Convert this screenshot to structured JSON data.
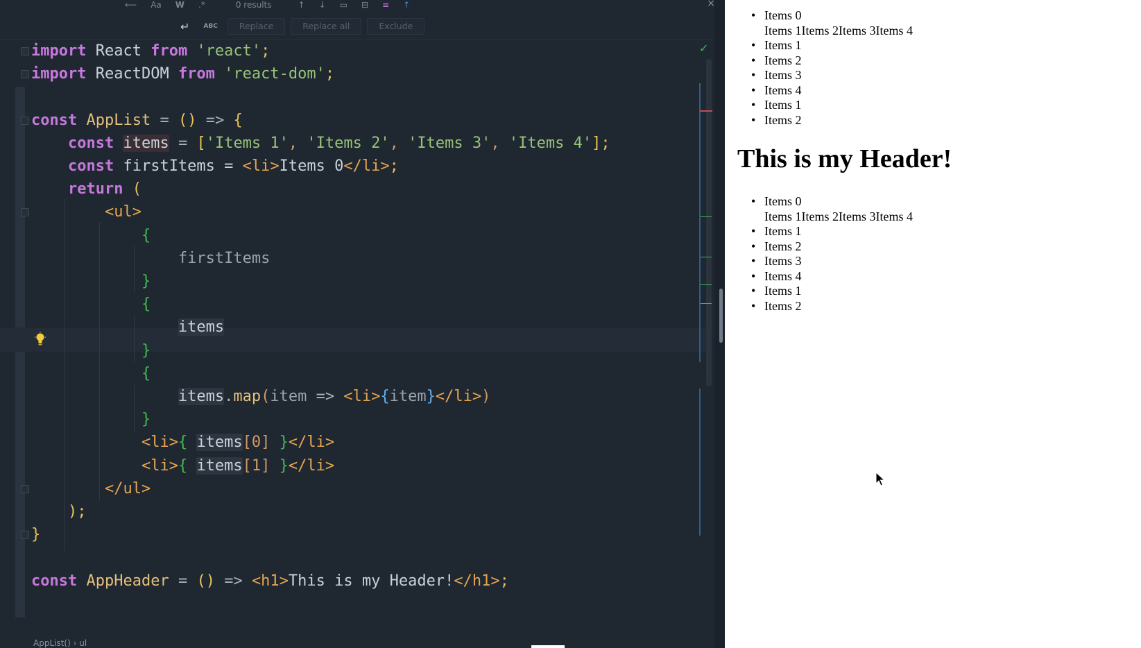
{
  "findbar": {
    "results": "0 results",
    "case_label": "Aa",
    "word_label": "W",
    "regex_label": ".*",
    "abc_label": "ABC",
    "replace_label": "Replace",
    "replace_all_label": "Replace all",
    "exclude_label": "Exclude",
    "close_label": "×"
  },
  "editor": {
    "lines": [
      {
        "tokens": [
          [
            "import",
            "k"
          ],
          [
            " React ",
            "v"
          ],
          [
            "from",
            "k"
          ],
          [
            " ",
            "v"
          ],
          [
            "'react'",
            "s"
          ],
          [
            ";",
            "y"
          ]
        ]
      },
      {
        "tokens": [
          [
            "import",
            "k"
          ],
          [
            " ReactDOM ",
            "v"
          ],
          [
            "from",
            "k"
          ],
          [
            " ",
            "v"
          ],
          [
            "'react-dom'",
            "s"
          ],
          [
            ";",
            "y"
          ]
        ]
      },
      {
        "tokens": []
      },
      {
        "tokens": [
          [
            "const",
            "k"
          ],
          [
            " ",
            "v"
          ],
          [
            "AppList",
            "fnb"
          ],
          [
            " = ",
            "p"
          ],
          [
            "()",
            "y"
          ],
          [
            " => ",
            "p"
          ],
          [
            "{",
            "y"
          ]
        ]
      },
      {
        "tokens": [
          [
            "    ",
            "v"
          ],
          [
            "const",
            "k"
          ],
          [
            " ",
            "v"
          ],
          [
            "items",
            "hlr"
          ],
          [
            " = ",
            "p"
          ],
          [
            "[",
            "y"
          ],
          [
            "'Items 1'",
            "s"
          ],
          [
            ", ",
            "pr"
          ],
          [
            "'Items 2'",
            "s"
          ],
          [
            ", ",
            "pr"
          ],
          [
            "'Items 3'",
            "s"
          ],
          [
            ", ",
            "pr"
          ],
          [
            "'Items 4'",
            "s"
          ],
          [
            "];",
            "y"
          ]
        ]
      },
      {
        "tokens": [
          [
            "    ",
            "v"
          ],
          [
            "const",
            "k"
          ],
          [
            " firstItems = ",
            "v"
          ],
          [
            "<li>",
            "t"
          ],
          [
            "Items 0",
            "v"
          ],
          [
            "</li>",
            "t"
          ],
          [
            ";",
            "y"
          ]
        ]
      },
      {
        "tokens": [
          [
            "    ",
            "v"
          ],
          [
            "return",
            "k"
          ],
          [
            " ",
            "v"
          ],
          [
            "(",
            "y"
          ]
        ]
      },
      {
        "tokens": [
          [
            "        ",
            "v"
          ],
          [
            "<ul>",
            "t"
          ]
        ]
      },
      {
        "tokens": [
          [
            "            ",
            "v"
          ],
          [
            "{",
            "br"
          ]
        ]
      },
      {
        "tokens": [
          [
            "                ",
            "v"
          ],
          [
            "firstItems",
            "gray"
          ]
        ]
      },
      {
        "tokens": [
          [
            "            ",
            "v"
          ],
          [
            "}",
            "br"
          ]
        ]
      },
      {
        "tokens": [
          [
            "            ",
            "v"
          ],
          [
            "{",
            "br"
          ]
        ]
      },
      {
        "tokens": [
          [
            "                ",
            "v"
          ],
          [
            "items",
            "hl"
          ]
        ]
      },
      {
        "tokens": [
          [
            "            ",
            "v"
          ],
          [
            "}",
            "br"
          ]
        ]
      },
      {
        "tokens": [
          [
            "            ",
            "v"
          ],
          [
            "{",
            "br"
          ]
        ]
      },
      {
        "tokens": [
          [
            "                ",
            "v"
          ],
          [
            "items",
            "hl"
          ],
          [
            ".",
            "p"
          ],
          [
            "map",
            "m"
          ],
          [
            "(",
            "pr"
          ],
          [
            "item",
            "gray"
          ],
          [
            " => ",
            "p"
          ],
          [
            "<li>",
            "t"
          ],
          [
            "{",
            "bl"
          ],
          [
            "item",
            "gray"
          ],
          [
            "}",
            "bl"
          ],
          [
            "</li>",
            "t"
          ],
          [
            ")",
            "pr"
          ]
        ]
      },
      {
        "tokens": [
          [
            "            ",
            "v"
          ],
          [
            "}",
            "br"
          ]
        ]
      },
      {
        "tokens": [
          [
            "            ",
            "v"
          ],
          [
            "<li>",
            "t"
          ],
          [
            "{ ",
            "br"
          ],
          [
            "items",
            "hl"
          ],
          [
            "[",
            "pr"
          ],
          [
            "0",
            "num"
          ],
          [
            "]",
            "pr"
          ],
          [
            " }",
            "br"
          ],
          [
            "</li>",
            "t"
          ]
        ]
      },
      {
        "tokens": [
          [
            "            ",
            "v"
          ],
          [
            "<li>",
            "t"
          ],
          [
            "{ ",
            "br"
          ],
          [
            "items",
            "hl"
          ],
          [
            "[",
            "pr"
          ],
          [
            "1",
            "num"
          ],
          [
            "]",
            "pr"
          ],
          [
            " }",
            "br"
          ],
          [
            "</li>",
            "t"
          ]
        ]
      },
      {
        "tokens": [
          [
            "        ",
            "v"
          ],
          [
            "</ul>",
            "t"
          ]
        ]
      },
      {
        "tokens": [
          [
            "    ",
            "v"
          ],
          [
            ");",
            "y"
          ]
        ]
      },
      {
        "tokens": [
          [
            "}",
            "y"
          ]
        ]
      },
      {
        "tokens": []
      },
      {
        "tokens": [
          [
            "const",
            "k"
          ],
          [
            " ",
            "v"
          ],
          [
            "AppHeader",
            "fnb"
          ],
          [
            " = ",
            "p"
          ],
          [
            "()",
            "y"
          ],
          [
            " => ",
            "p"
          ],
          [
            "<h1>",
            "t"
          ],
          [
            "This is my Header!",
            "v"
          ],
          [
            "</h1>",
            "t"
          ],
          [
            ";",
            "y"
          ]
        ]
      }
    ],
    "breadcrumb": "AppList() › ul"
  },
  "preview": {
    "list1": [
      "Items 0",
      "Items 1Items 2Items 3Items 4",
      "Items 1",
      "Items 2",
      "Items 3",
      "Items 4",
      "Items 1",
      "Items 2"
    ],
    "header": "This is my Header!",
    "list2": [
      "Items 0",
      "Items 1Items 2Items 3Items 4",
      "Items 1",
      "Items 2",
      "Items 3",
      "Items 4",
      "Items 1",
      "Items 2"
    ]
  }
}
